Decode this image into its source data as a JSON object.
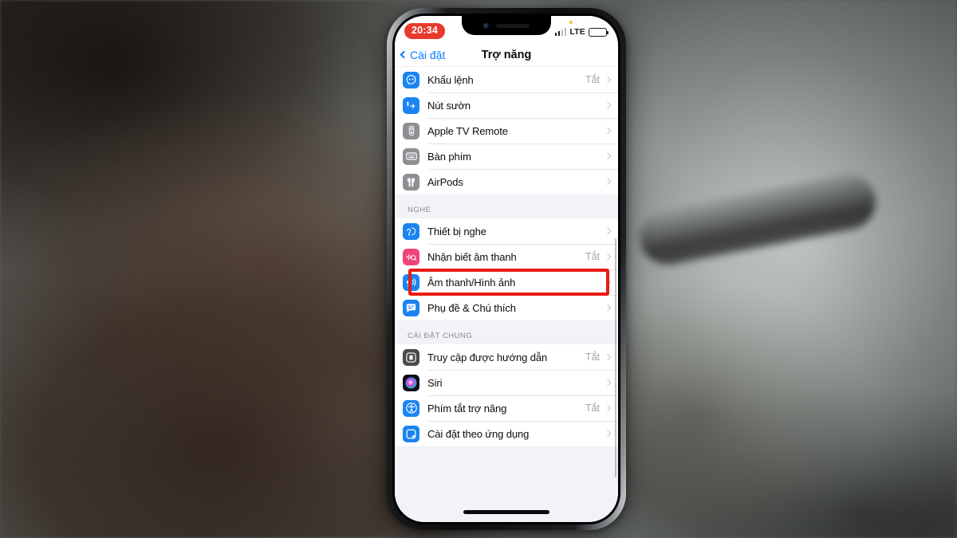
{
  "device": {
    "status_bar": {
      "time": "20:34",
      "carrier_network": "LTE",
      "signal_icon": "cellular-bars-icon",
      "battery_icon": "battery-icon",
      "recording_dot_icon": "orange-indicator-dot"
    },
    "home_indicator": "home-indicator"
  },
  "nav": {
    "back_label": "Cài đặt",
    "title": "Trợ năng"
  },
  "sections": [
    {
      "header": "",
      "rows": [
        {
          "label": "Khẩu lệnh",
          "value": "Tắt",
          "icon": "voice-control-icon",
          "icon_color": "#1b84f2"
        },
        {
          "label": "Nút sườn",
          "value": "",
          "icon": "side-button-icon",
          "icon_color": "#1b84f2"
        },
        {
          "label": "Apple TV Remote",
          "value": "",
          "icon": "apple-tv-remote-icon",
          "icon_color": "#8e8e93"
        },
        {
          "label": "Bàn phím",
          "value": "",
          "icon": "keyboard-icon",
          "icon_color": "#8e8e93"
        },
        {
          "label": "AirPods",
          "value": "",
          "icon": "airpods-icon",
          "icon_color": "#8e8e93"
        }
      ]
    },
    {
      "header": "NGHE",
      "rows": [
        {
          "label": "Thiết bị nghe",
          "value": "",
          "icon": "hearing-devices-icon",
          "icon_color": "#1b84f2"
        },
        {
          "label": "Nhận biết âm thanh",
          "value": "Tắt",
          "icon": "sound-recognition-icon",
          "icon_color": "#f2447b"
        },
        {
          "label": "Âm thanh/Hình ảnh",
          "value": "",
          "icon": "audio-visual-icon",
          "icon_color": "#1b84f2",
          "highlighted": true
        },
        {
          "label": "Phụ đề & Chú thích",
          "value": "",
          "icon": "subtitles-captions-icon",
          "icon_color": "#1b84f2"
        }
      ]
    },
    {
      "header": "CÀI ĐẶT CHUNG",
      "rows": [
        {
          "label": "Truy cập được hướng dẫn",
          "value": "Tắt",
          "icon": "guided-access-icon",
          "icon_color": "#4a4a4f"
        },
        {
          "label": "Siri",
          "value": "",
          "icon": "siri-icon",
          "icon_color": "#1b1b2f"
        },
        {
          "label": "Phím tắt trợ năng",
          "value": "Tắt",
          "icon": "accessibility-icon",
          "icon_color": "#1b84f2"
        },
        {
          "label": "Cài đặt theo ứng dụng",
          "value": "",
          "icon": "per-app-settings-icon",
          "icon_color": "#1b84f2"
        }
      ]
    }
  ],
  "annotation": {
    "highlight_color": "#e81b12",
    "highlight_target": "Âm thanh/Hình ảnh"
  }
}
